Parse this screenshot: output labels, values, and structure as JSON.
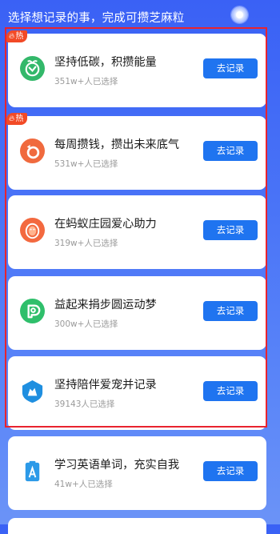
{
  "header": {
    "title": "选择想记录的事，完成可攒芝麻粒",
    "icon": "sesame-coin-icon"
  },
  "colors": {
    "background": "#4a74f7",
    "button": "#1f74f0",
    "hot_badge": "#f24a26",
    "highlight_border": "#e8232e"
  },
  "tasks": [
    {
      "title": "坚持低碳，积攒能量",
      "subtitle": "351w+人已选择",
      "button": "去记录",
      "badge": "热",
      "icon": "leaf-eco-icon",
      "icon_color": "#33b86a"
    },
    {
      "title": "每周攒钱，攒出未来底气",
      "subtitle": "531w+人已选择",
      "button": "去记录",
      "badge": "热",
      "icon": "savings-piggy-icon",
      "icon_color": "#f06a3e"
    },
    {
      "title": "在蚂蚁庄园爱心助力",
      "subtitle": "319w+人已选择",
      "button": "去记录",
      "badge": "",
      "icon": "chick-egg-icon",
      "icon_color": "#f3693f"
    },
    {
      "title": "益起来捐步圆运动梦",
      "subtitle": "300w+人已选择",
      "button": "去记录",
      "badge": "",
      "icon": "charity-steps-icon",
      "icon_color": "#2fbf6b"
    },
    {
      "title": "坚持陪伴爱宠并记录",
      "subtitle": "39143人已选择",
      "button": "去记录",
      "badge": "",
      "icon": "pet-shield-icon",
      "icon_color": "#1f8fe0"
    },
    {
      "title": "学习英语单词，充实自我",
      "subtitle": "41w+人已选择",
      "button": "去记录",
      "badge": "",
      "icon": "english-vocab-icon",
      "icon_color": "#2c9ae8"
    }
  ]
}
